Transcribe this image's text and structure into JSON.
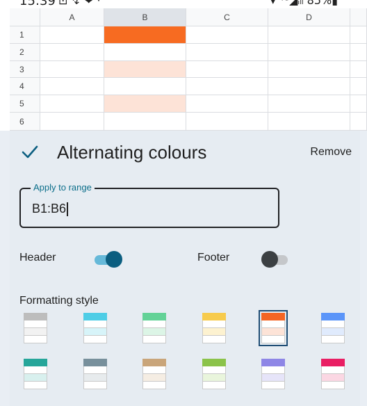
{
  "status_bar": {
    "time": "15:39",
    "left_icons": "⊡ ↯ ❤ ·",
    "right_icons": "▾ ⁴ᴳ◢ᵢₗₗ 85%▮"
  },
  "sheet": {
    "columns": [
      "A",
      "B",
      "C",
      "D"
    ],
    "rows": [
      "1",
      "2",
      "3",
      "4",
      "5",
      "6"
    ],
    "header_fill": "#f76b21",
    "alt_fill": "#fde3d7"
  },
  "panel": {
    "title": "Alternating colours",
    "remove_label": "Remove",
    "range_label": "Apply to range",
    "range_value": "B1:B6",
    "header_label": "Header",
    "header_on": true,
    "footer_label": "Footer",
    "footer_on": false,
    "formatting_label": "Formatting style",
    "styles": [
      {
        "header": "#bdbdbd",
        "alt": "#f2f2f2"
      },
      {
        "header": "#4ecde6",
        "alt": "#d7f4f9"
      },
      {
        "header": "#63d297",
        "alt": "#dcf5e6"
      },
      {
        "header": "#f7cb4d",
        "alt": "#fdf2d0"
      },
      {
        "header": "#f46524",
        "alt": "#fde3d7",
        "selected": true
      },
      {
        "header": "#5b95f9",
        "alt": "#e0ebfd"
      },
      {
        "header": "#26a69a",
        "alt": "#d8f0ee"
      },
      {
        "header": "#78909c",
        "alt": "#e7ebed"
      },
      {
        "header": "#c9a57a",
        "alt": "#f5ede3"
      },
      {
        "header": "#8bc34a",
        "alt": "#e9f5dc"
      },
      {
        "header": "#8e86e6",
        "alt": "#e6e4f9"
      },
      {
        "header": "#e91e63",
        "alt": "#fbd7e3"
      }
    ]
  }
}
